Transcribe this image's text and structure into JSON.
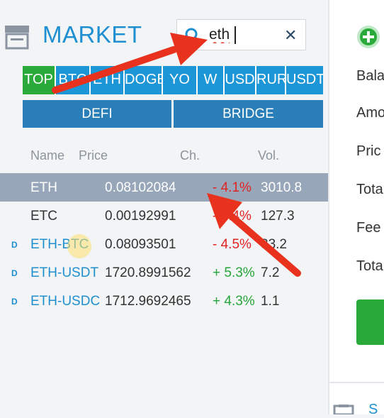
{
  "header": {
    "title": "MARKET"
  },
  "search": {
    "value": "eth",
    "placeholder": ""
  },
  "tabs": [
    {
      "label": "TOP",
      "active": true
    },
    {
      "label": "BTC"
    },
    {
      "label": "ETH"
    },
    {
      "label": "DOGE"
    },
    {
      "label": "YO"
    },
    {
      "label": "W"
    },
    {
      "label": "USD"
    },
    {
      "label": "RUR"
    },
    {
      "label": "USDT"
    }
  ],
  "segments": [
    {
      "label": "DEFI"
    },
    {
      "label": "BRIDGE"
    }
  ],
  "table": {
    "headers": {
      "name": "Name",
      "price": "Price",
      "change": "Ch.",
      "volume": "Vol."
    },
    "rows": [
      {
        "badge": "",
        "pair": "ETH",
        "price": "0.08102084",
        "change": "- 4.1%",
        "volume": "3010.8",
        "selected": true
      },
      {
        "badge": "",
        "pair": "ETC",
        "price": "0.00192991",
        "change": "- 3.4%",
        "volume": "127.3"
      },
      {
        "badge": "D",
        "pair": "ETH-BTC",
        "price": "0.08093501",
        "change": "- 4.5%",
        "volume": "33.2"
      },
      {
        "badge": "D",
        "pair": "ETH-USDT",
        "price": "1720.8991562",
        "change": "+ 5.3%",
        "volume": "7.2"
      },
      {
        "badge": "D",
        "pair": "ETH-USDC",
        "price": "1712.9692465",
        "change": "+ 4.3%",
        "volume": "1.1"
      }
    ]
  },
  "side_panel": {
    "labels": [
      "Bala",
      "Amo",
      "Pric",
      "Tota",
      "Fee",
      "Tota"
    ],
    "bottom_label": "S"
  },
  "colors": {
    "accent": "#1e8fd0",
    "active_tab": "#2aaa3a",
    "negative": "#e02323",
    "positive": "#26a63a",
    "selected_row": "#97a6b8",
    "annotation": "#e8321e"
  }
}
